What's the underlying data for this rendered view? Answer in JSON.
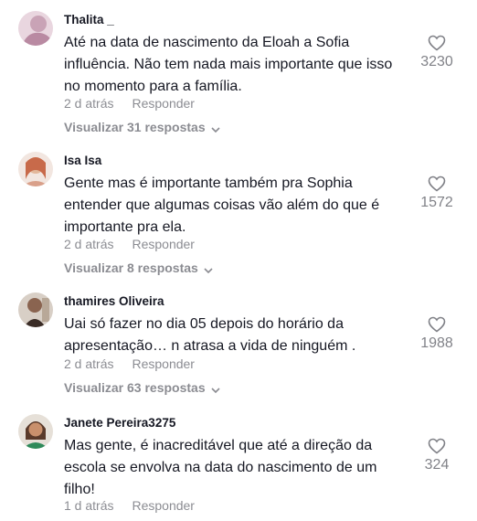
{
  "comments": [
    {
      "username": "Thalita _",
      "text": "Até na data de nascimento da Eloah a Sofia influência. Não tem nada mais importante que isso no momento para a família.",
      "time": "2 d atrás",
      "reply_label": "Responder",
      "view_replies": "Visualizar 31 respostas",
      "likes": "3230",
      "avatar_color": "#d8b8c8"
    },
    {
      "username": "Isa Isa",
      "text": "Gente mas é importante também pra Sophia entender que algumas coisas vão além do que é importante pra ela.",
      "time": "2 d atrás",
      "reply_label": "Responder",
      "view_replies": "Visualizar 8 respostas",
      "likes": "1572",
      "avatar_color": "#c98a6a"
    },
    {
      "username": "thamires Oliveira",
      "text": "Uai só fazer no dia 05 depois do horário da apresentação… n atrasa a vida de ninguém .",
      "time": "2 d atrás",
      "reply_label": "Responder",
      "view_replies": "Visualizar 63 respostas",
      "likes": "1988",
      "avatar_color": "#7a5a48"
    },
    {
      "username": "Janete Pereira3275",
      "text": "Mas gente, é inacreditável que até a direção da escola se envolva na data do nascimento de um filho!",
      "time": "1 d atrás",
      "reply_label": "Responder",
      "likes": "324",
      "avatar_color": "#b07a58"
    }
  ]
}
